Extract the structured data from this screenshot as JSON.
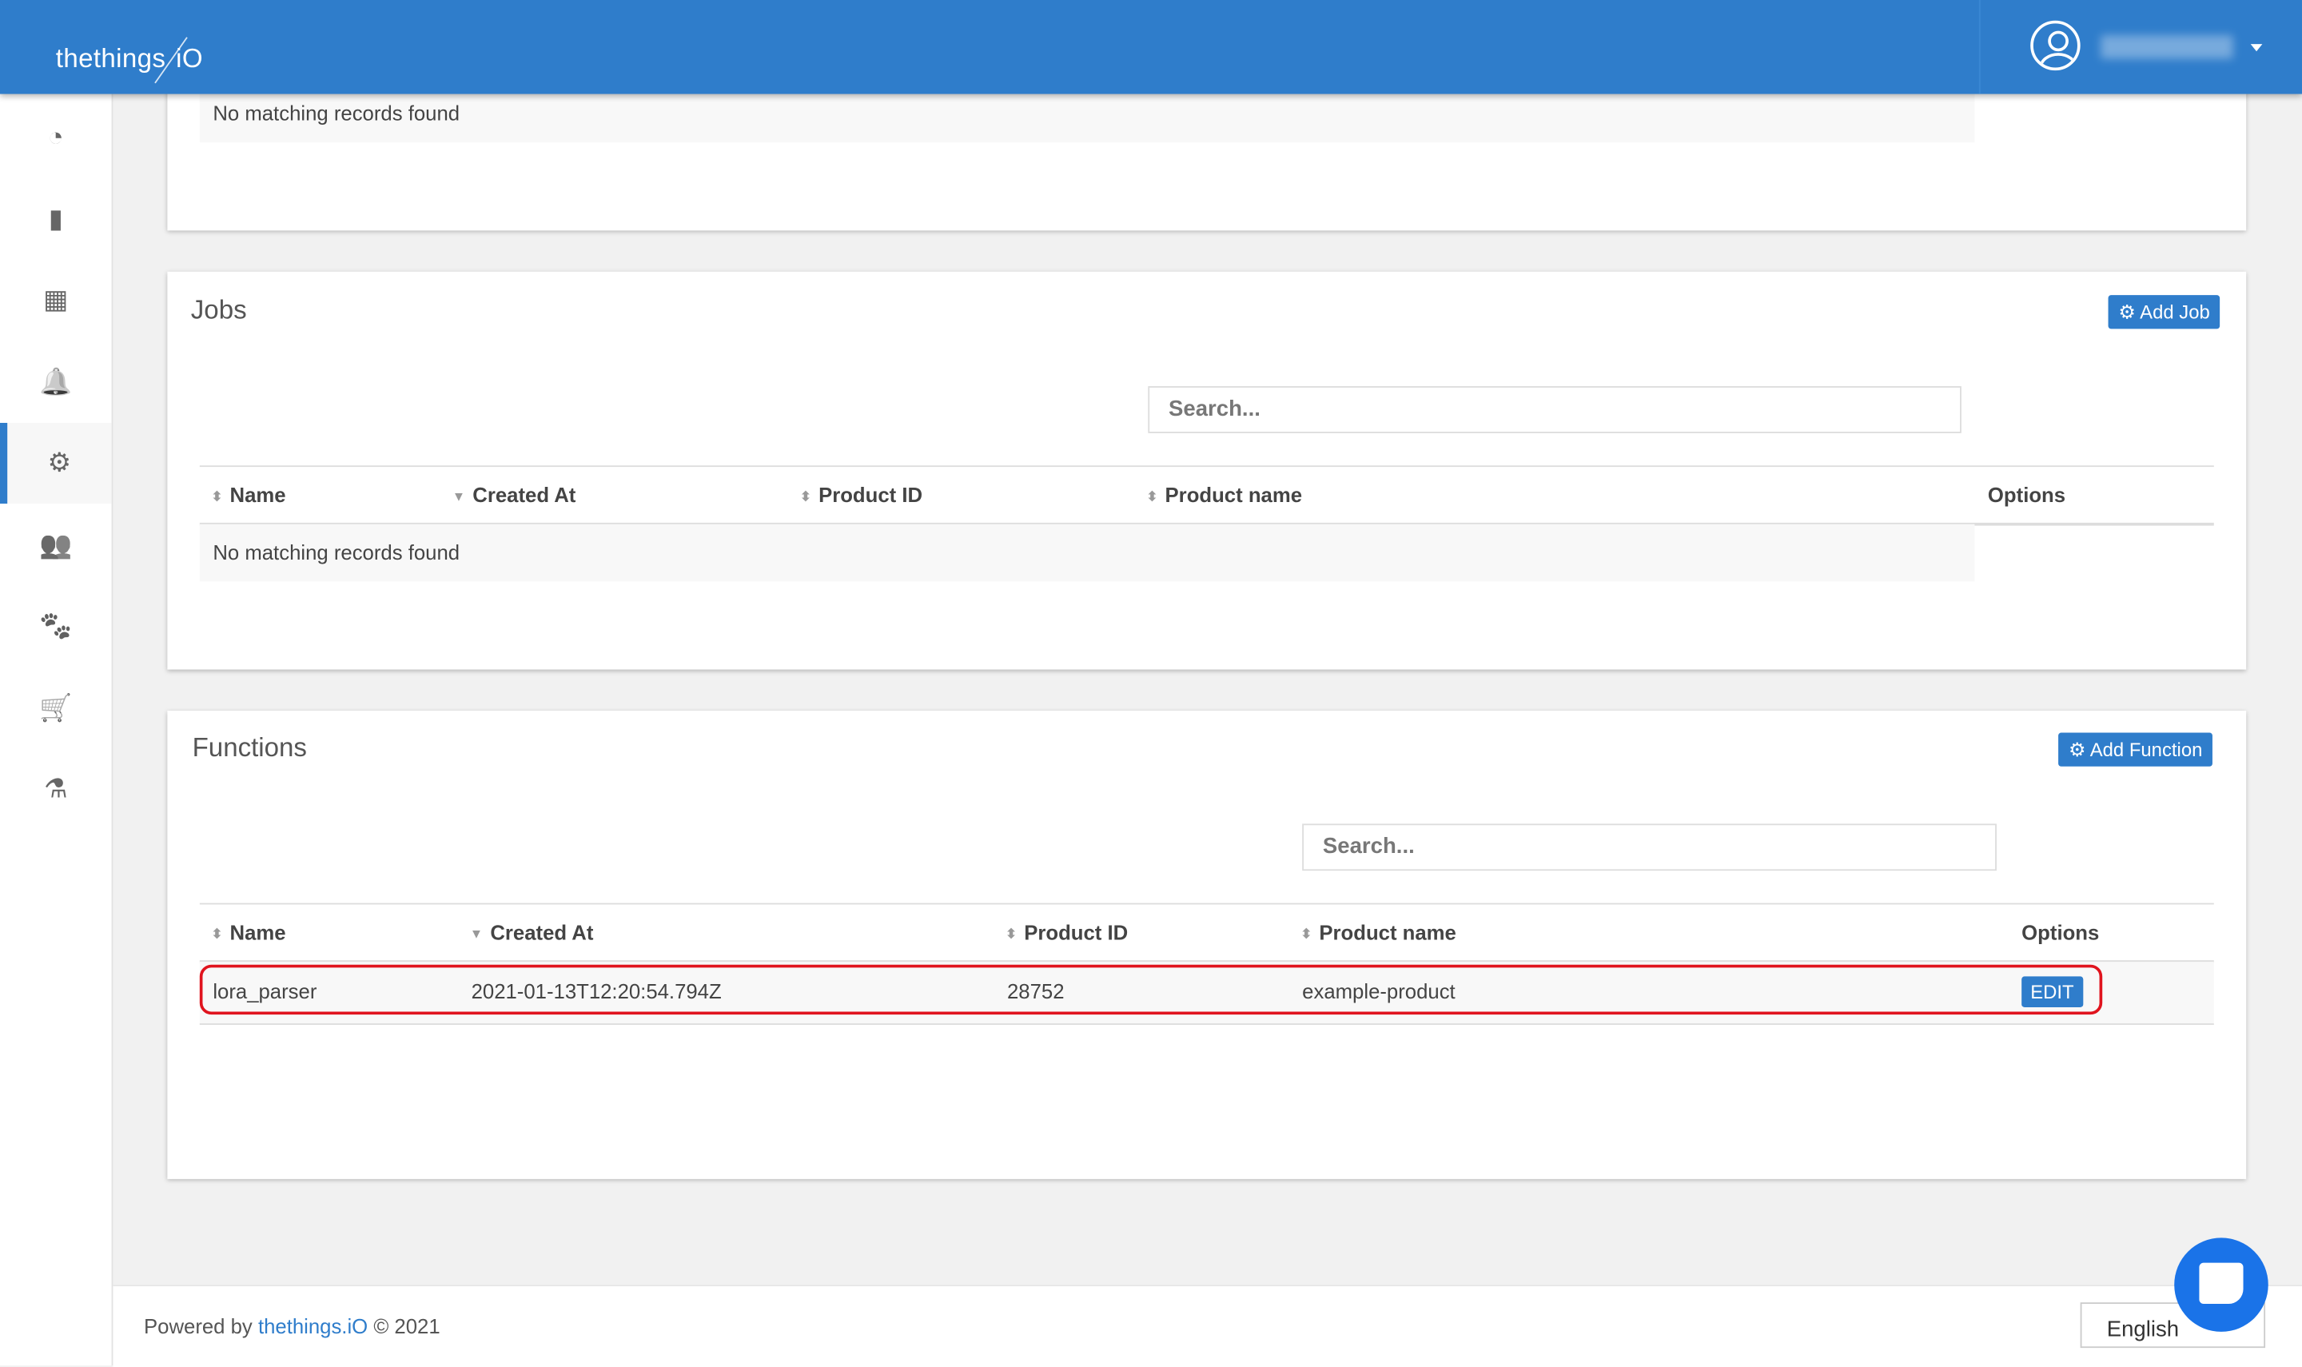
{
  "header": {
    "logo": "thethings.iO",
    "username": "username"
  },
  "sidebar": {
    "items": [
      {
        "name": "dashboard",
        "icon": "dashboard-icon",
        "glyph": "◔"
      },
      {
        "name": "things",
        "icon": "chip-icon",
        "glyph": "▮"
      },
      {
        "name": "products",
        "icon": "grid-icon",
        "glyph": "▦"
      },
      {
        "name": "alerts",
        "icon": "bell-icon",
        "glyph": "🔔"
      },
      {
        "name": "cloud-code",
        "icon": "gears-icon",
        "glyph": "⚙"
      },
      {
        "name": "users",
        "icon": "users-icon",
        "glyph": "👥"
      },
      {
        "name": "resources",
        "icon": "paw-icon",
        "glyph": "🐾"
      },
      {
        "name": "shop",
        "icon": "cart-icon",
        "glyph": "🛒"
      },
      {
        "name": "labs",
        "icon": "flask-icon",
        "glyph": "⚗"
      }
    ]
  },
  "top_card": {
    "empty": "No matching records found"
  },
  "jobs": {
    "title": "Jobs",
    "add_label": "Add Job",
    "search_placeholder": "Search...",
    "columns": [
      "Name",
      "Created At",
      "Product ID",
      "Product name",
      "Options"
    ],
    "empty": "No matching records found"
  },
  "functions": {
    "title": "Functions",
    "add_label": "Add Function",
    "search_placeholder": "Search...",
    "columns": [
      "Name",
      "Created At",
      "Product ID",
      "Product name",
      "Options"
    ],
    "rows": [
      {
        "name": "lora_parser",
        "created_at": "2021-01-13T12:20:54.794Z",
        "product_id": "28752",
        "product_name": "example-product",
        "option": "EDIT"
      }
    ]
  },
  "footer": {
    "powered": "Powered by",
    "brand": "thethings.iO",
    "copyright": "© 2021",
    "language": "English"
  },
  "colors": {
    "primary": "#2f7dcb",
    "highlight": "#e0141e"
  }
}
